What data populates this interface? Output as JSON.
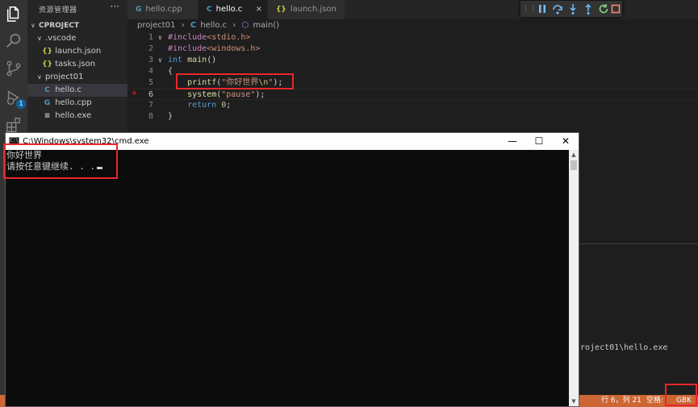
{
  "colors": {
    "activity_bg": "#333333",
    "sidebar_bg": "#252526",
    "editor_bg": "#1e1e1e",
    "statusbar_bg": "#cc6633",
    "annotation_red": "#e8282b",
    "cmd_bg": "#0c0c0c"
  },
  "activity_bar": {
    "icons": [
      "files-icon",
      "search-icon",
      "source-control-icon",
      "run-debug-icon",
      "extensions-icon"
    ],
    "debug_badge": "1"
  },
  "sidebar": {
    "title": "资源管理器",
    "more": "···",
    "items": [
      {
        "label": "CPROJECT",
        "chevron": "∨",
        "icon": ""
      },
      {
        "label": ".vscode",
        "chevron": "∨",
        "icon": ""
      },
      {
        "label": "launch.json",
        "chevron": "",
        "icon": "{}"
      },
      {
        "label": "tasks.json",
        "chevron": "",
        "icon": "{}"
      },
      {
        "label": "project01",
        "chevron": "∨",
        "icon": ""
      },
      {
        "label": "hello.c",
        "chevron": "",
        "icon": "C"
      },
      {
        "label": "hello.cpp",
        "chevron": "",
        "icon": "G"
      },
      {
        "label": "hello.exe",
        "chevron": "",
        "icon": "≡"
      }
    ]
  },
  "tabs": [
    {
      "label": "hello.cpp",
      "icon": "G"
    },
    {
      "label": "hello.c",
      "icon": "C",
      "close": "×"
    },
    {
      "label": "launch.json",
      "icon": "{}"
    }
  ],
  "debug_toolbar": {
    "grip": "⋮⋮",
    "buttons": [
      "pause-icon",
      "step-over-icon",
      "step-into-icon",
      "step-out-icon",
      "restart-icon",
      "stop-icon"
    ]
  },
  "breadcrumb": {
    "folder": "project01",
    "sep1": "›",
    "file_icon": "C",
    "file": "hello.c",
    "sep2": "›",
    "symbol_icon": "⬡",
    "symbol": "main()"
  },
  "code": {
    "lines": [
      {
        "num": "1",
        "fold": "∨",
        "parts": [
          {
            "c": "pp",
            "t": "#include"
          },
          {
            "c": "str",
            "t": "<stdio.h>"
          }
        ]
      },
      {
        "num": "2",
        "fold": "",
        "parts": [
          {
            "c": "pp",
            "t": "#include"
          },
          {
            "c": "str",
            "t": "<windows.h>"
          }
        ]
      },
      {
        "num": "3",
        "fold": "∨",
        "parts": [
          {
            "c": "kw",
            "t": "int"
          },
          {
            "c": "plain",
            "t": " "
          },
          {
            "c": "fn",
            "t": "main"
          },
          {
            "c": "plain",
            "t": "()"
          }
        ]
      },
      {
        "num": "4",
        "fold": "",
        "parts": [
          {
            "c": "plain",
            "t": "{"
          }
        ]
      },
      {
        "num": "5",
        "fold": "",
        "parts": [
          {
            "c": "plain",
            "t": "    "
          },
          {
            "c": "fn",
            "t": "printf"
          },
          {
            "c": "plain",
            "t": "("
          },
          {
            "c": "str",
            "t": "\"你好世界"
          },
          {
            "c": "esc",
            "t": "\\n"
          },
          {
            "c": "str",
            "t": "\""
          },
          {
            "c": "plain",
            "t": ");"
          }
        ]
      },
      {
        "num": "6",
        "fold": "",
        "parts": [
          {
            "c": "plain",
            "t": "    "
          },
          {
            "c": "fn",
            "t": "system"
          },
          {
            "c": "plain",
            "t": "("
          },
          {
            "c": "str",
            "t": "\"pause\""
          },
          {
            "c": "plain",
            "t": ");"
          }
        ]
      },
      {
        "num": "7",
        "fold": "",
        "parts": [
          {
            "c": "plain",
            "t": "    "
          },
          {
            "c": "kw",
            "t": "return"
          },
          {
            "c": "plain",
            "t": " "
          },
          {
            "c": "num",
            "t": "0"
          },
          {
            "c": "plain",
            "t": ";"
          }
        ]
      },
      {
        "num": "8",
        "fold": "",
        "parts": [
          {
            "c": "plain",
            "t": "}"
          }
        ]
      }
    ]
  },
  "terminal_panel": {
    "visible_text": "roject01\\hello.exe"
  },
  "cmd_window": {
    "title": "C:\\Windows\\system32\\cmd.exe",
    "icon_text": "C:\\",
    "minimize": "—",
    "maximize": "☐",
    "close": "✕",
    "output": [
      "你好世界",
      "请按任意键继续. . ."
    ],
    "scroll_up": "▲",
    "scroll_down": "▼"
  },
  "status_bar": {
    "position": "行 6，列 21",
    "spaces": "空格:",
    "encoding": "GBK"
  }
}
